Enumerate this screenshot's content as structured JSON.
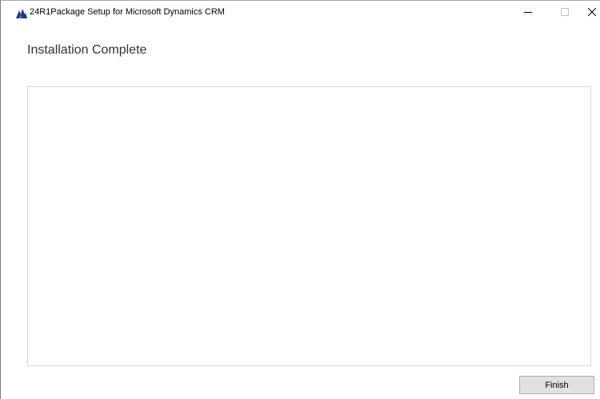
{
  "window": {
    "title": "24R1Package Setup for Microsoft Dynamics CRM",
    "icon": "dynamics-crm-logo-icon",
    "controls": {
      "minimize_icon": "minimize-icon",
      "maximize_icon": "maximize-icon",
      "close_icon": "close-icon"
    }
  },
  "page": {
    "heading": "Installation Complete"
  },
  "footer": {
    "finish_label": "Finish"
  },
  "colors": {
    "icon_accent": "#1a3a6b",
    "panel_border": "#d9d9d9",
    "button_bg": "#e1e1e1",
    "button_border": "#adadad",
    "heading_text": "#333333"
  }
}
